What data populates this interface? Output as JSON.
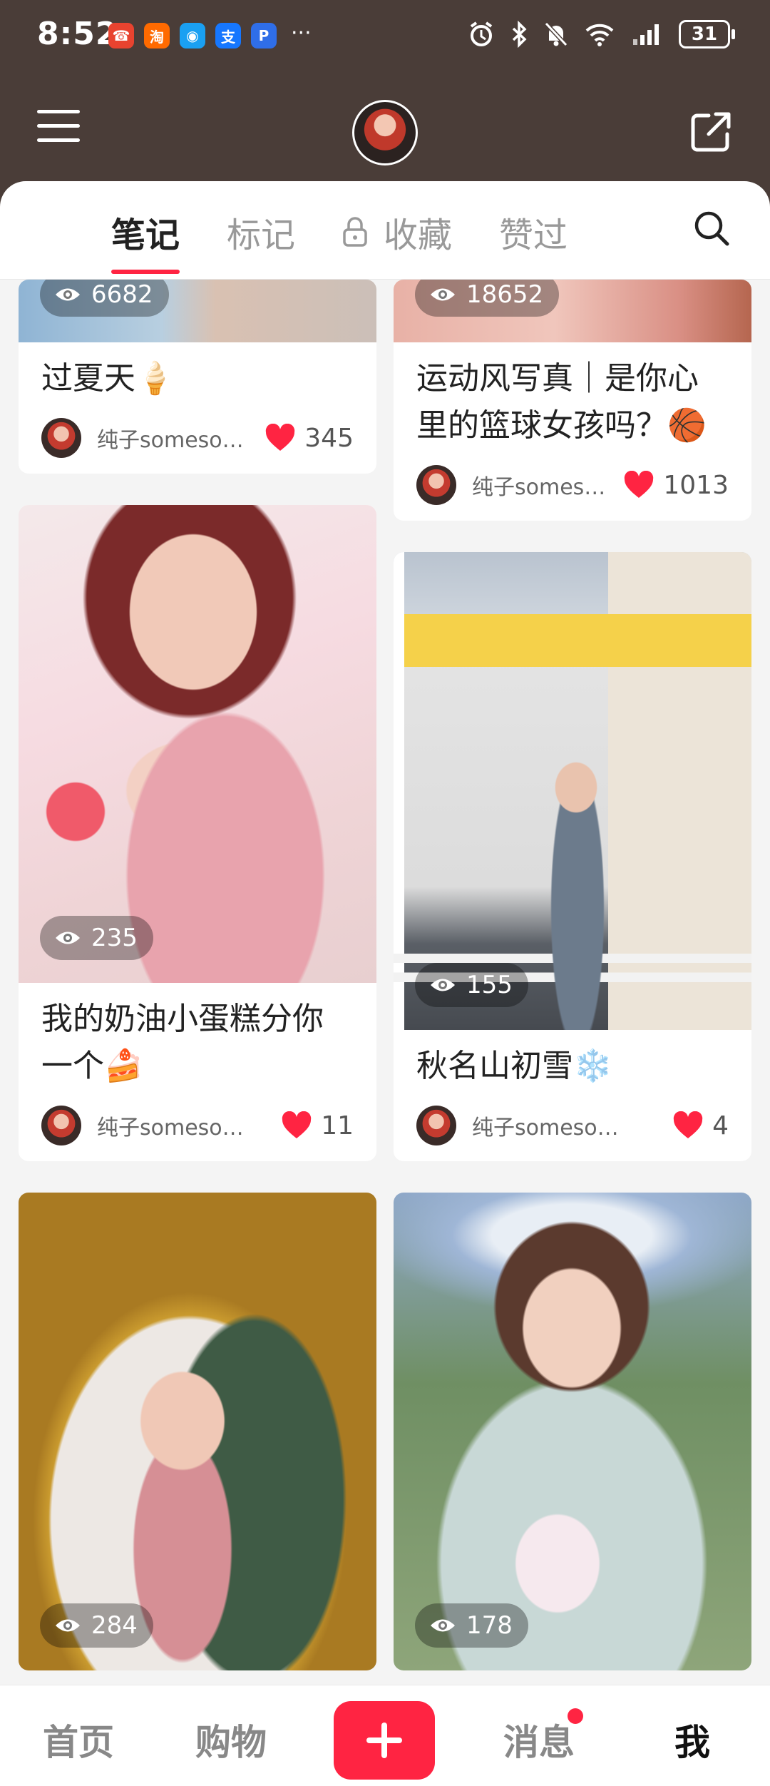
{
  "status_bar": {
    "time": "8:52",
    "battery": "31",
    "app_icons": [
      {
        "name": "phone-app-icon",
        "glyph": "☎",
        "color": "#e8432f"
      },
      {
        "name": "taobao-app-icon",
        "glyph": "淘",
        "color": "#ff6a00"
      },
      {
        "name": "qq-app-icon",
        "glyph": "◉",
        "color": "#1aa0f2"
      },
      {
        "name": "alipay-app-icon",
        "glyph": "支",
        "color": "#1677ff"
      },
      {
        "name": "payment-app-icon",
        "glyph": "P",
        "color": "#2f6ee8"
      }
    ],
    "more": "···"
  },
  "header": {
    "menu_icon": "menu-icon",
    "avatar": "profile-avatar",
    "share_icon": "share-icon"
  },
  "tabs": [
    {
      "label": "笔记",
      "active": true
    },
    {
      "label": "标记",
      "active": false
    },
    {
      "label": "收藏",
      "active": false,
      "icon": "lock-icon"
    },
    {
      "label": "赞过",
      "active": false
    }
  ],
  "search_icon": "search-icon",
  "feed": [
    {
      "views": "6682",
      "title": "过夏天🍦",
      "author": "纯子somesome",
      "likes": "345"
    },
    {
      "views": "18652",
      "title": "运动风写真｜是你心里的篮球女孩吗？🏀",
      "author": "纯子somes…",
      "likes": "1013"
    },
    {
      "views": "235",
      "title": "我的奶油小蛋糕分你一个🍰",
      "author": "纯子somesome",
      "likes": "11"
    },
    {
      "views": "155",
      "title": "秋名山初雪❄️",
      "author": "纯子somesome",
      "likes": "4"
    },
    {
      "views": "284",
      "title": "",
      "author": "",
      "likes": ""
    },
    {
      "views": "178",
      "title": "",
      "author": "",
      "likes": ""
    }
  ],
  "bottom_nav": {
    "home": "首页",
    "shop": "购物",
    "messages": "消息",
    "me": "我",
    "messages_has_dot": true
  },
  "colors": {
    "accent": "#ff2442",
    "header_bg": "#4a3d38"
  }
}
